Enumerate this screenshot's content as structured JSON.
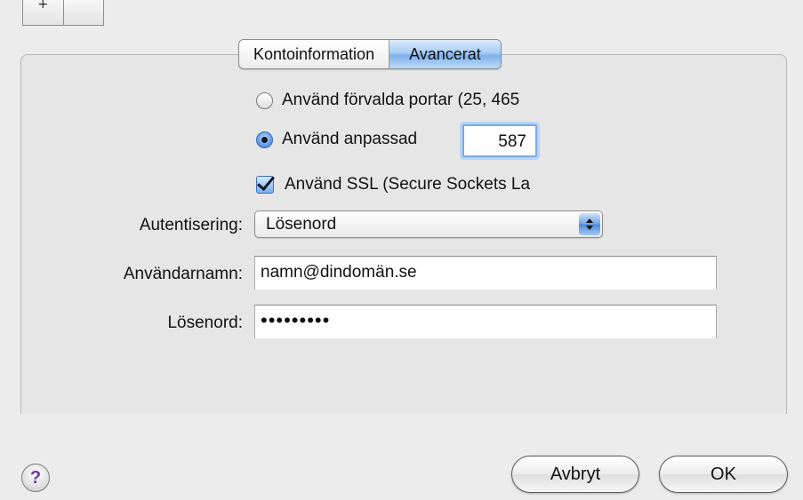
{
  "top_segments": [
    "+",
    ""
  ],
  "tabs": [
    {
      "label": "Kontoinformation",
      "selected": false
    },
    {
      "label": "Avancerat",
      "selected": true
    }
  ],
  "ports": {
    "default_option": "Använd förvalda portar (25, 465",
    "custom_option": "Använd anpassad",
    "selected": "custom",
    "custom_value": "587"
  },
  "ssl": {
    "label": "Använd SSL (Secure Sockets La",
    "checked": true
  },
  "form": {
    "auth_label": "Autentisering:",
    "auth_value": "Lösenord",
    "username_label": "Användarnamn:",
    "username_value": "namn@dindomän.se",
    "password_label": "Lösenord:",
    "password_value": "•••••••••"
  },
  "buttons": {
    "help": "?",
    "cancel": "Avbryt",
    "ok": "OK"
  },
  "colors": {
    "accent": "#7fb2ec",
    "window_bg": "#ececec"
  }
}
